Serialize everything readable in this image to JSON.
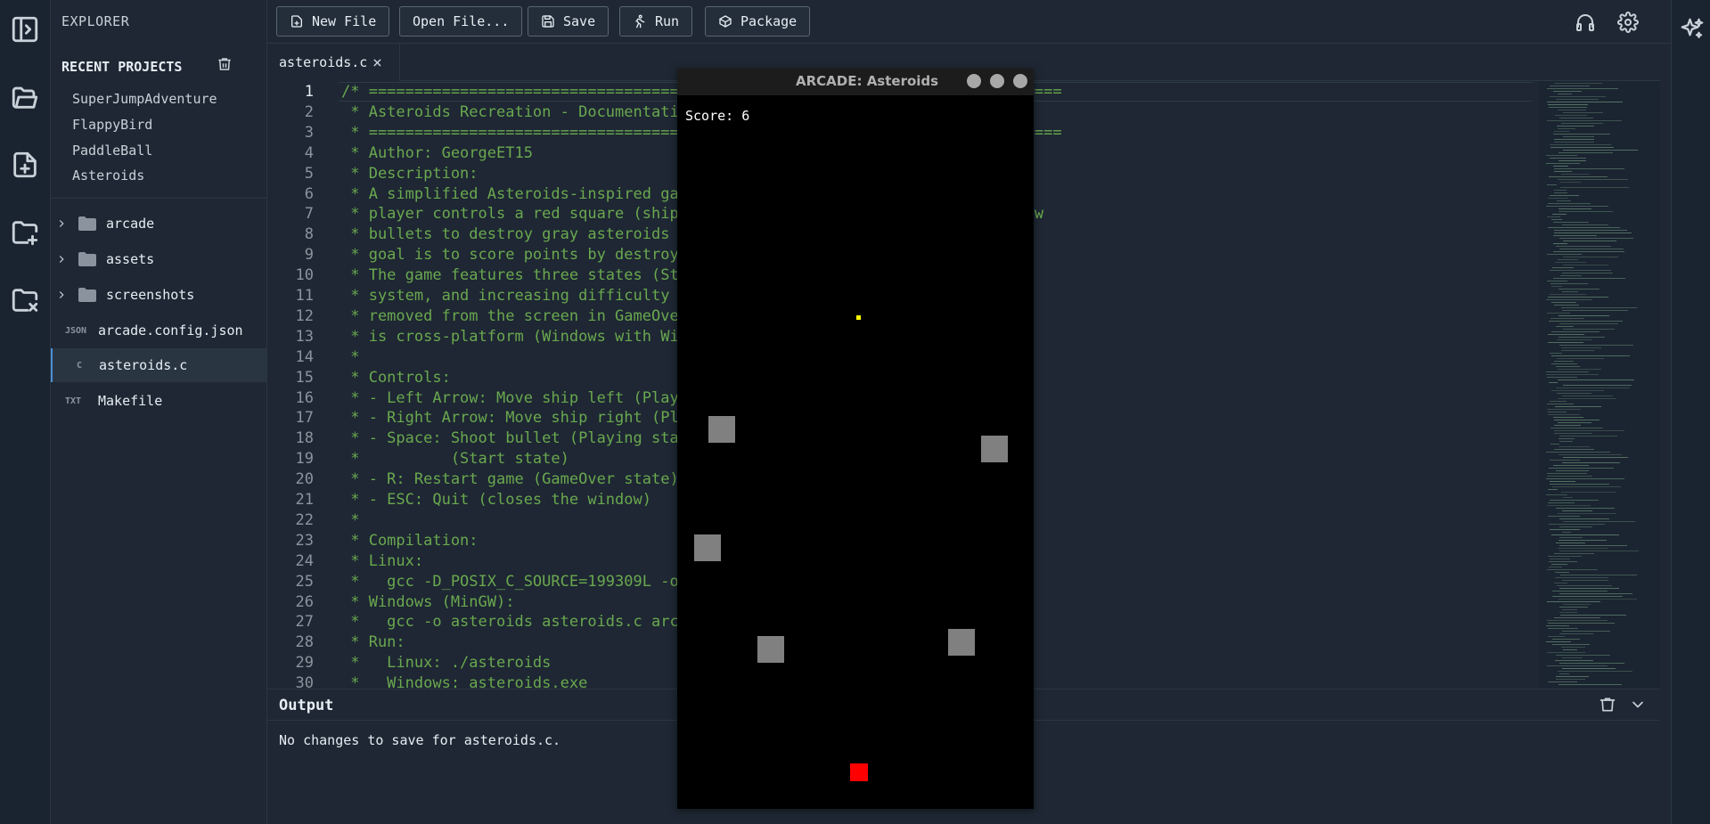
{
  "explorer": {
    "title": "EXPLORER",
    "recent_title": "RECENT PROJECTS",
    "recent_projects": [
      "SuperJumpAdventure",
      "FlappyBird",
      "PaddleBall",
      "Asteroids"
    ],
    "tree": [
      {
        "label": "arcade",
        "type": "folder"
      },
      {
        "label": "assets",
        "type": "folder"
      },
      {
        "label": "screenshots",
        "type": "folder"
      },
      {
        "label": "arcade.config.json",
        "type": "file",
        "badge": "JSON"
      },
      {
        "label": "asteroids.c",
        "type": "file",
        "badge": "C",
        "active": true
      },
      {
        "label": "Makefile",
        "type": "file",
        "badge": "TXT"
      }
    ]
  },
  "toolbar": {
    "new_file": "New File",
    "open_file": "Open File...",
    "save": "Save",
    "run": "Run",
    "package": "Package"
  },
  "tabs": [
    {
      "label": "asteroids.c",
      "close": "×"
    }
  ],
  "editor": {
    "current_line": 1,
    "lines": [
      "/* ============================================================================",
      " * Asteroids Recreation - Documentation",
      " * ============================================================================",
      " * Author: GeorgeET15",
      " * Description:",
      " * A simplified Asteroids-inspired game",
      " * player controls a red square (ship)                                     ow",
      " * bullets to destroy gray asteroids",
      " * goal is to score points by destroy",
      " * The game features three states (Sta",
      " * system, and increasing difficulty",
      " * removed from the screen in GameOve                                      l",
      " * is cross-platform (Windows with Wi",
      " *",
      " * Controls:",
      " * - Left Arrow: Move ship left (Play",
      " * - Right Arrow: Move ship right (Pl",
      " * - Space: Shoot bullet (Playing stat",
      " *          (Start state)",
      " * - R: Restart game (GameOver state)",
      " * - ESC: Quit (closes the window)",
      " *",
      " * Compilation:",
      " * Linux:",
      " *   gcc -D_POSIX_C_SOURCE=199309L -o                                      m",
      " * Windows (MinGW):",
      " *   gcc -o asteroids asteroids.c arca",
      " * Run:",
      " *   Linux: ./asteroids",
      " *   Windows: asteroids.exe"
    ]
  },
  "output": {
    "title": "Output",
    "message": "No changes to save for asteroids.c."
  },
  "game_window": {
    "title": "ARCADE: Asteroids",
    "score_text": "Score: 6",
    "colors": {
      "asteroid": "#808080",
      "ship": "#ff0000",
      "bullet": "#ffff00",
      "background": "#000000"
    }
  },
  "colors": {
    "background": "#1e2733",
    "comment": "#6aa84f",
    "accent": "#4c8fd6"
  }
}
